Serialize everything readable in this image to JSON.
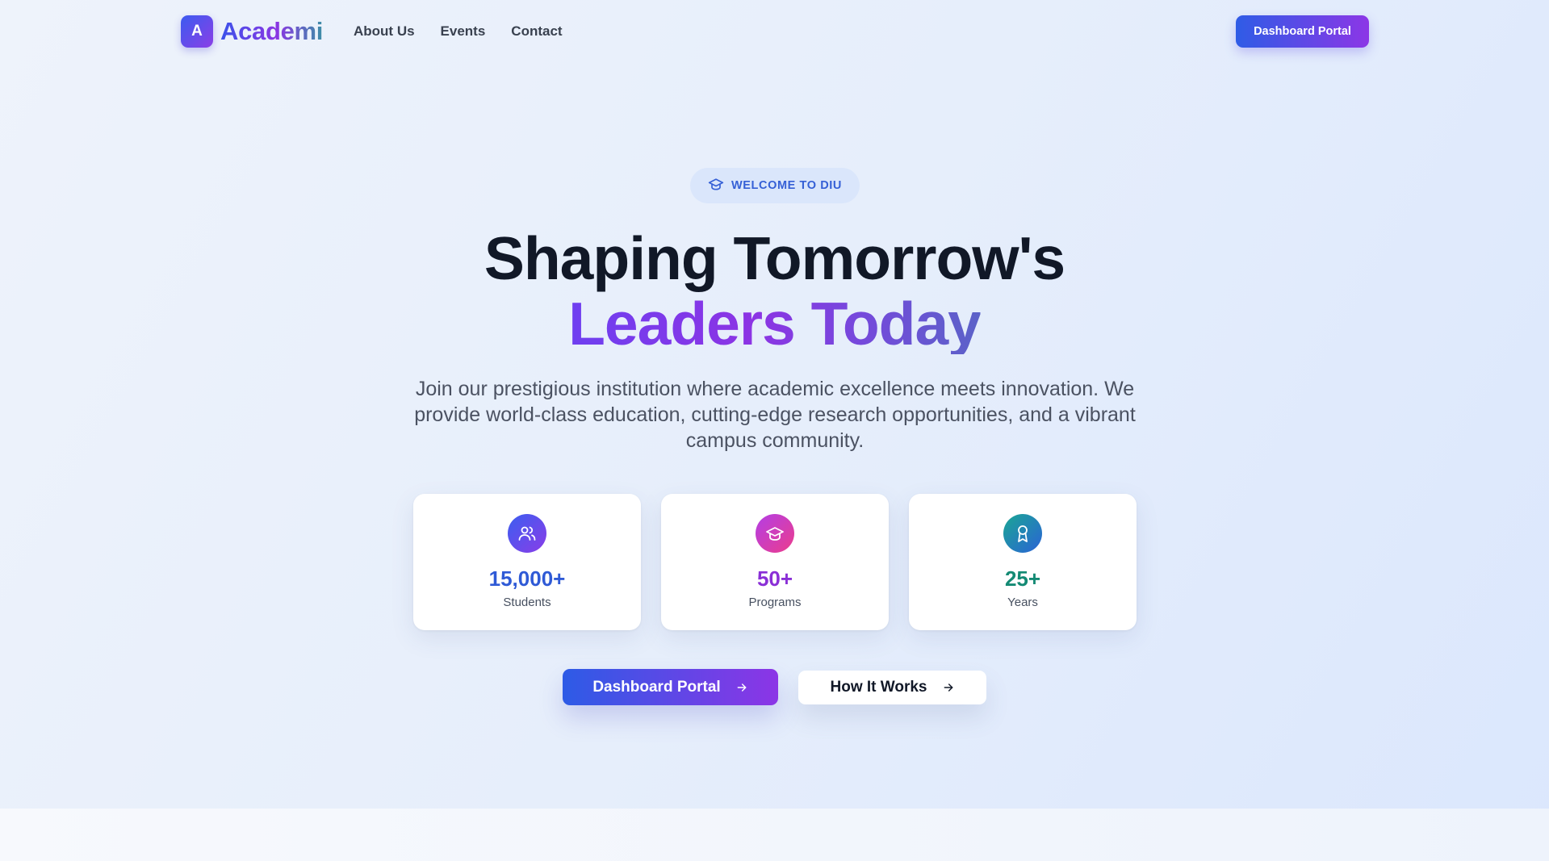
{
  "brand": {
    "logo_letter": "A",
    "name": "Academi"
  },
  "nav": {
    "links": [
      "About Us",
      "Events",
      "Contact"
    ],
    "cta_label": "Dashboard Portal"
  },
  "hero": {
    "badge": "WELCOME TO DIU",
    "headline_line1": "Shaping Tomorrow's",
    "headline_line2": "Leaders Today",
    "subtitle": "Join our prestigious institution where academic excellence meets innovation. We provide world-class education, cutting-edge research opportunities, and a vibrant campus community."
  },
  "stats": [
    {
      "icon": "users-icon",
      "value": "15,000+",
      "label": "Students",
      "color": "#2f5ad6"
    },
    {
      "icon": "graduation-cap-icon",
      "value": "50+",
      "label": "Programs",
      "color": "#8a2fd6"
    },
    {
      "icon": "award-icon",
      "value": "25+",
      "label": "Years",
      "color": "#148a74"
    }
  ],
  "actions": {
    "primary_label": "Dashboard Portal",
    "secondary_label": "How It Works"
  },
  "colors": {
    "accent_blue": "#2f5ce6",
    "accent_purple": "#8c36e6",
    "heading": "#111827"
  }
}
